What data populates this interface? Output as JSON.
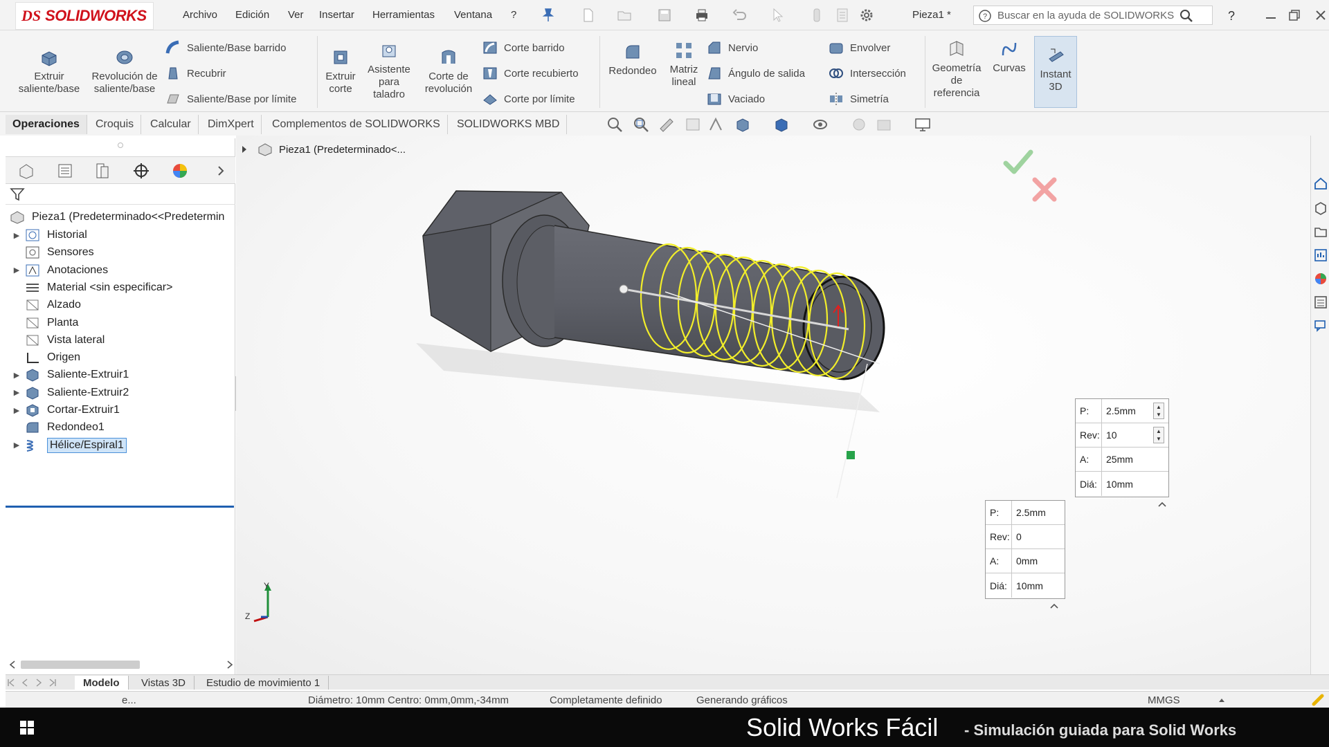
{
  "app": {
    "logo_prefix": "DS",
    "logo_text": "SOLIDWORKS",
    "doc_name": "Pieza1 *",
    "help_search_placeholder": "Buscar en la ayuda de SOLIDWORKS",
    "help_label": "?"
  },
  "menu": [
    "Archivo",
    "Edición",
    "Ver",
    "Insertar",
    "Herramientas",
    "Ventana",
    "?"
  ],
  "ribbon": {
    "extruir_saliente": "Extruir saliente/base",
    "revolucion_saliente": "Revolución de saliente/base",
    "saliente_barrido": "Saliente/Base barrido",
    "recubrir": "Recubrir",
    "saliente_limite": "Saliente/Base por límite",
    "extruir_corte": "Extruir corte",
    "asistente_taladro": "Asistente para taladro",
    "corte_revolucion": "Corte de revolución",
    "corte_barrido": "Corte barrido",
    "corte_recubierto": "Corte recubierto",
    "corte_limite": "Corte por límite",
    "redondeo": "Redondeo",
    "matriz_lineal": "Matriz lineal",
    "nervio": "Nervio",
    "angulo_salida": "Ángulo de salida",
    "vaciado": "Vaciado",
    "envolver": "Envolver",
    "interseccion": "Intersección",
    "simetria": "Simetría",
    "geometria_referencia": "Geometría de referencia",
    "curvas": "Curvas",
    "instant3d": "Instant 3D"
  },
  "command_tabs": [
    "Operaciones",
    "Croquis",
    "Calcular",
    "DimXpert",
    "Complementos de SOLIDWORKS",
    "SOLIDWORKS MBD"
  ],
  "active_command_tab": "Operaciones",
  "tree": {
    "root": "Pieza1  (Predeterminado<<Predetermin",
    "items": [
      {
        "label": "Historial",
        "expandable": true,
        "icon": "history-icon"
      },
      {
        "label": "Sensores",
        "expandable": false,
        "icon": "sensor-icon"
      },
      {
        "label": "Anotaciones",
        "expandable": true,
        "icon": "annotation-icon"
      },
      {
        "label": "Material <sin especificar>",
        "expandable": false,
        "icon": "material-icon"
      },
      {
        "label": "Alzado",
        "expandable": false,
        "icon": "plane-icon"
      },
      {
        "label": "Planta",
        "expandable": false,
        "icon": "plane-icon"
      },
      {
        "label": "Vista lateral",
        "expandable": false,
        "icon": "plane-icon"
      },
      {
        "label": "Origen",
        "expandable": false,
        "icon": "origin-icon"
      },
      {
        "label": "Saliente-Extruir1",
        "expandable": true,
        "icon": "extrude-icon"
      },
      {
        "label": "Saliente-Extruir2",
        "expandable": true,
        "icon": "extrude-icon"
      },
      {
        "label": "Cortar-Extruir1",
        "expandable": true,
        "icon": "cut-extrude-icon"
      },
      {
        "label": "Redondeo1",
        "expandable": false,
        "icon": "fillet-icon"
      },
      {
        "label": "Hélice/Espiral1",
        "expandable": true,
        "icon": "helix-icon",
        "selected": true
      }
    ]
  },
  "viewport": {
    "breadcrumb": "Pieza1  (Predeterminado<...",
    "triad_z": "Z",
    "triad_y": "Y"
  },
  "callout_end": {
    "p_key": "P:",
    "p": "2.5mm",
    "rev_key": "Rev:",
    "rev": "10",
    "a_key": "A:",
    "a": "25mm",
    "dia_key": "Diá:",
    "dia": "10mm"
  },
  "callout_start": {
    "p_key": "P:",
    "p": "2.5mm",
    "rev_key": "Rev:",
    "rev": "0",
    "a_key": "A:",
    "a": "0mm",
    "dia_key": "Diá:",
    "dia": "10mm"
  },
  "bottom_tabs": [
    "Modelo",
    "Vistas 3D",
    "Estudio de movimiento 1"
  ],
  "active_bottom_tab": "Modelo",
  "status": {
    "left": "e...",
    "diametro": "Diámetro: 10mm  Centro: 0mm,0mm,-34mm",
    "definido": "Completamente definido",
    "generando": "Generando gráficos",
    "units": "MMGS"
  },
  "brand": {
    "title": "Solid Works Fácil",
    "subtitle": "- Simulación guiada para Solid Works"
  },
  "colors": {
    "accent_red": "#d0111b",
    "helix_yellow": "#f2ee2a",
    "selection_blue": "#1f5fb0"
  }
}
